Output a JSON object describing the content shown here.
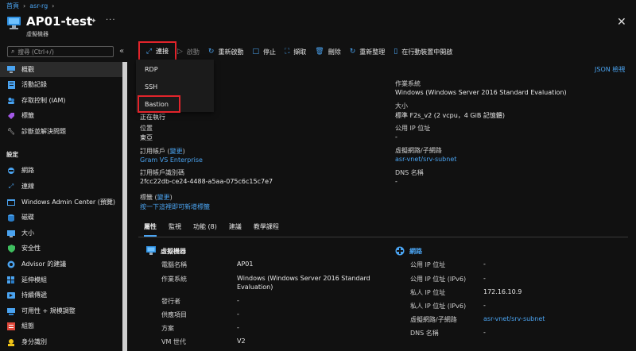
{
  "breadcrumb": [
    "首頁",
    "asr-rg"
  ],
  "header": {
    "title": "AP01-test",
    "subtitle": "虛擬機器",
    "more": "···",
    "close": "✕"
  },
  "search": {
    "placeholder": "搜尋 (Ctrl+/)",
    "collapse": "«"
  },
  "sidebar": {
    "items": [
      {
        "label": "概觀",
        "icon": "monitor-icon",
        "color": "#4aa3f0"
      },
      {
        "label": "活動記錄",
        "icon": "activity-log-icon",
        "color": "#4aa3f0"
      },
      {
        "label": "存取控制 (IAM)",
        "icon": "iam-icon",
        "color": "#4aa3f0"
      },
      {
        "label": "標籤",
        "icon": "tag-icon",
        "color": "#a259e6"
      },
      {
        "label": "診斷並解決問題",
        "icon": "wrench-icon",
        "color": "#cfcfcf"
      }
    ],
    "section": "設定",
    "settings": [
      {
        "label": "網路",
        "icon": "network-icon",
        "color": "#4aa3f0"
      },
      {
        "label": "連線",
        "icon": "connect-icon",
        "color": "#4aa3f0"
      },
      {
        "label": "Windows Admin Center (預覽)",
        "icon": "admin-center-icon",
        "color": "#4aa3f0"
      },
      {
        "label": "磁碟",
        "icon": "disk-icon",
        "color": "#4aa3f0"
      },
      {
        "label": "大小",
        "icon": "size-icon",
        "color": "#4aa3f0"
      },
      {
        "label": "安全性",
        "icon": "shield-icon",
        "color": "#3fbf5f"
      },
      {
        "label": "Advisor 的建議",
        "icon": "advisor-icon",
        "color": "#4aa3f0"
      },
      {
        "label": "延伸模組",
        "icon": "extensions-icon",
        "color": "#4aa3f0"
      },
      {
        "label": "持續傳遞",
        "icon": "delivery-icon",
        "color": "#4aa3f0"
      },
      {
        "label": "可用性 + 規模調整",
        "icon": "availability-icon",
        "color": "#4aa3f0"
      },
      {
        "label": "組態",
        "icon": "config-icon",
        "color": "#e0483b"
      },
      {
        "label": "身分識別",
        "icon": "identity-icon",
        "color": "#f0c419"
      }
    ]
  },
  "toolbar": {
    "connect": "連接",
    "start": "啟動",
    "restart": "重新啟動",
    "stop": "停止",
    "capture": "擷取",
    "delete": "刪除",
    "refresh": "重新整理",
    "mobile": "在行動裝置中開啟"
  },
  "connect_menu": [
    "RDP",
    "SSH",
    "Bastion"
  ],
  "essentials": {
    "json_view": "JSON 檢視",
    "status_value": "正在執行",
    "location_label": "位置",
    "location_value": "東亞",
    "subscription_label": "訂用帳戶 (",
    "subscription_change": "變更",
    "subscription_close": ")",
    "subscription_value": "Gram VS Enterprise",
    "subscription_id_label": "訂用帳戶識別碼",
    "subscription_id_value": "2fcc22db-ce24-4488-a5aa-075c6c15c7e7",
    "tags_label": "標籤 (",
    "tags_change": "變更",
    "tags_close": ")",
    "tags_value": "按一下這裡即可新增標籤",
    "os_label": "作業系統",
    "os_value": "Windows (Windows Server 2016 Standard Evaluation)",
    "size_label": "大小",
    "size_value": "標準 F2s_v2 (2 vcpu，4 GiB 記憶體)",
    "public_ip_label": "公用 IP 位址",
    "public_ip_value": "-",
    "vnet_label": "虛擬網路/子網路",
    "vnet_value": "asr-vnet/srv-subnet",
    "dns_label": "DNS 名稱",
    "dns_value": "-"
  },
  "tabs": [
    {
      "label": "屬性",
      "active": true
    },
    {
      "label": "監視",
      "active": false
    },
    {
      "label": "功能 (8)",
      "active": false
    },
    {
      "label": "建議",
      "active": false
    },
    {
      "label": "教學課程",
      "active": false
    }
  ],
  "vm_props": {
    "title": "虛擬機器",
    "rows": [
      {
        "label": "電腦名稱",
        "value": "AP01"
      },
      {
        "label": "作業系統",
        "value": "Windows (Windows Server 2016 Standard",
        "value2": "Evaluation)"
      },
      {
        "label": "發行者",
        "value": "-"
      },
      {
        "label": "供應項目",
        "value": "-"
      },
      {
        "label": "方案",
        "value": "-"
      },
      {
        "label": "VM 世代",
        "value": "V2"
      }
    ]
  },
  "net_props": {
    "title": "網路",
    "rows": [
      {
        "label": "公用 IP 位址",
        "value": "-"
      },
      {
        "label": "公用 IP 位址 (IPv6)",
        "value": "-"
      },
      {
        "label": "私人 IP 位址",
        "value": "172.16.10.9"
      },
      {
        "label": "私人 IP 位址 (IPv6)",
        "value": "-"
      },
      {
        "label": "虛擬網路/子網路",
        "value": "asr-vnet/srv-subnet"
      },
      {
        "label": "DNS 名稱",
        "value": "-"
      }
    ]
  }
}
